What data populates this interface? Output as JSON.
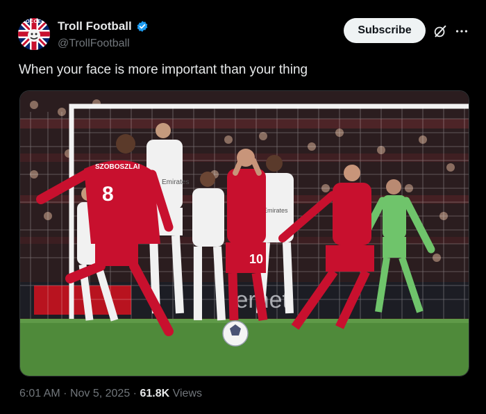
{
  "author": {
    "name": "Troll Football",
    "handle": "@TrollFootball",
    "verified": true,
    "avatar_text": "SOCCER"
  },
  "actions": {
    "subscribe_label": "Subscribe",
    "grok_icon": "slash-circle-icon",
    "more_icon": "more-dots-icon"
  },
  "post": {
    "text": "When your face is more important than your thing"
  },
  "media": {
    "player_name": "SZOBOSZLAI",
    "player_number": "8",
    "player2_number": "10",
    "ad_text_left": "Emirates",
    "ad_text_mid": "Emirates",
    "board_text": "ternet"
  },
  "meta": {
    "time": "6:01 AM",
    "separator": "·",
    "date": "Nov 5, 2025",
    "views_count": "61.8K",
    "views_label": "Views"
  },
  "colors": {
    "background": "#000000",
    "accent_blue": "#1d9bf0",
    "liverpool_red": "#c8102e",
    "madrid_white": "#f1f1f1",
    "pitch_green": "#4f8a3a"
  }
}
